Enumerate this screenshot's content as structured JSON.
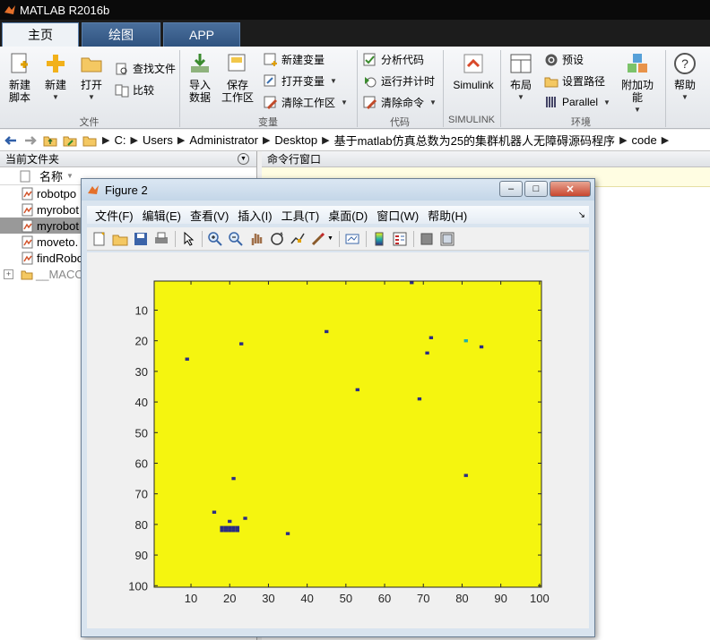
{
  "window": {
    "title": "MATLAB R2016b"
  },
  "tabs": [
    {
      "label": "主页",
      "active": true
    },
    {
      "label": "绘图",
      "active": false
    },
    {
      "label": "APP",
      "active": false
    }
  ],
  "ribbon": {
    "new_script": "新建\n脚本",
    "new": "新建",
    "open": "打开",
    "find_files": "查找文件",
    "compare": "比较",
    "import_data": "导入\n数据",
    "save_workspace": "保存\n工作区",
    "new_variable": "新建变量",
    "open_variable": "打开变量",
    "clear_workspace": "清除工作区",
    "analyze_code": "分析代码",
    "run_and_time": "运行并计时",
    "clear_commands": "清除命令",
    "simulink": "Simulink",
    "layout": "布局",
    "preferences": "预设",
    "set_path": "设置路径",
    "parallel": "Parallel",
    "addons": "附加功能",
    "help": "帮助",
    "groups": {
      "file": "文件",
      "variable": "变量",
      "code": "代码",
      "simulink": "SIMULINK",
      "environment": "环境"
    }
  },
  "address": {
    "crumbs": [
      "C:",
      "Users",
      "Administrator",
      "Desktop",
      "基于matlab仿真总数为25的集群机器人无障碍源码程序",
      "code"
    ]
  },
  "current_folder": {
    "title": "当前文件夹",
    "column": "名称",
    "files": [
      {
        "name": "robotpo",
        "selected": false
      },
      {
        "name": "myrobot",
        "selected": false
      },
      {
        "name": "myrobot",
        "selected": true
      },
      {
        "name": "moveto.",
        "selected": false
      },
      {
        "name": "findRobo",
        "selected": false
      },
      {
        "name": "__MACO",
        "selected": false
      }
    ]
  },
  "command_window": {
    "title": "命令行窗口"
  },
  "figure": {
    "title": "Figure 2",
    "menu": [
      "文件(F)",
      "编辑(E)",
      "查看(V)",
      "插入(I)",
      "工具(T)",
      "桌面(D)",
      "窗口(W)",
      "帮助(H)"
    ]
  },
  "colors": {
    "field": "#f5f50f",
    "obstacle": "#2b2c84",
    "target": "#21b1a8",
    "text_tab_active": "#000000"
  },
  "chart_data": {
    "type": "heatmap",
    "title": "",
    "xlabel": "",
    "ylabel": "",
    "xlim": [
      0.5,
      100.5
    ],
    "ylim": [
      100.5,
      0.5
    ],
    "y_reversed": true,
    "xticks": [
      10,
      20,
      30,
      40,
      50,
      60,
      70,
      80,
      90,
      100
    ],
    "yticks": [
      10,
      20,
      30,
      40,
      50,
      60,
      70,
      80,
      90,
      100
    ],
    "background_value_color": "#f5f50f",
    "cells": [
      {
        "x": 67,
        "y": 1,
        "color": "#2b2c84"
      },
      {
        "x": 9,
        "y": 26,
        "color": "#2b2c84"
      },
      {
        "x": 23,
        "y": 21,
        "color": "#2b2c84"
      },
      {
        "x": 45,
        "y": 17,
        "color": "#2b2c84"
      },
      {
        "x": 72,
        "y": 19,
        "color": "#2b2c84"
      },
      {
        "x": 81,
        "y": 20,
        "color": "#21b1a8"
      },
      {
        "x": 85,
        "y": 22,
        "color": "#2b2c84"
      },
      {
        "x": 71,
        "y": 24,
        "color": "#2b2c84"
      },
      {
        "x": 53,
        "y": 36,
        "color": "#2b2c84"
      },
      {
        "x": 69,
        "y": 39,
        "color": "#2b2c84"
      },
      {
        "x": 81,
        "y": 64,
        "color": "#2b2c84"
      },
      {
        "x": 21,
        "y": 65,
        "color": "#2b2c84"
      },
      {
        "x": 16,
        "y": 76,
        "color": "#2b2c84"
      },
      {
        "x": 24,
        "y": 78,
        "color": "#2b2c84"
      },
      {
        "x": 20,
        "y": 79,
        "color": "#2b2c84"
      },
      {
        "x": 18,
        "y": 81,
        "color": "#2b2c84"
      },
      {
        "x": 19,
        "y": 81,
        "color": "#2b2c84"
      },
      {
        "x": 20,
        "y": 81,
        "color": "#2b2c84"
      },
      {
        "x": 21,
        "y": 81,
        "color": "#2b2c84"
      },
      {
        "x": 22,
        "y": 81,
        "color": "#2b2c84"
      },
      {
        "x": 18,
        "y": 82,
        "color": "#2b2c84"
      },
      {
        "x": 19,
        "y": 82,
        "color": "#2b2c84"
      },
      {
        "x": 20,
        "y": 82,
        "color": "#2b2c84"
      },
      {
        "x": 21,
        "y": 82,
        "color": "#2b2c84"
      },
      {
        "x": 22,
        "y": 82,
        "color": "#2b2c84"
      },
      {
        "x": 35,
        "y": 83,
        "color": "#2b2c84"
      }
    ]
  }
}
